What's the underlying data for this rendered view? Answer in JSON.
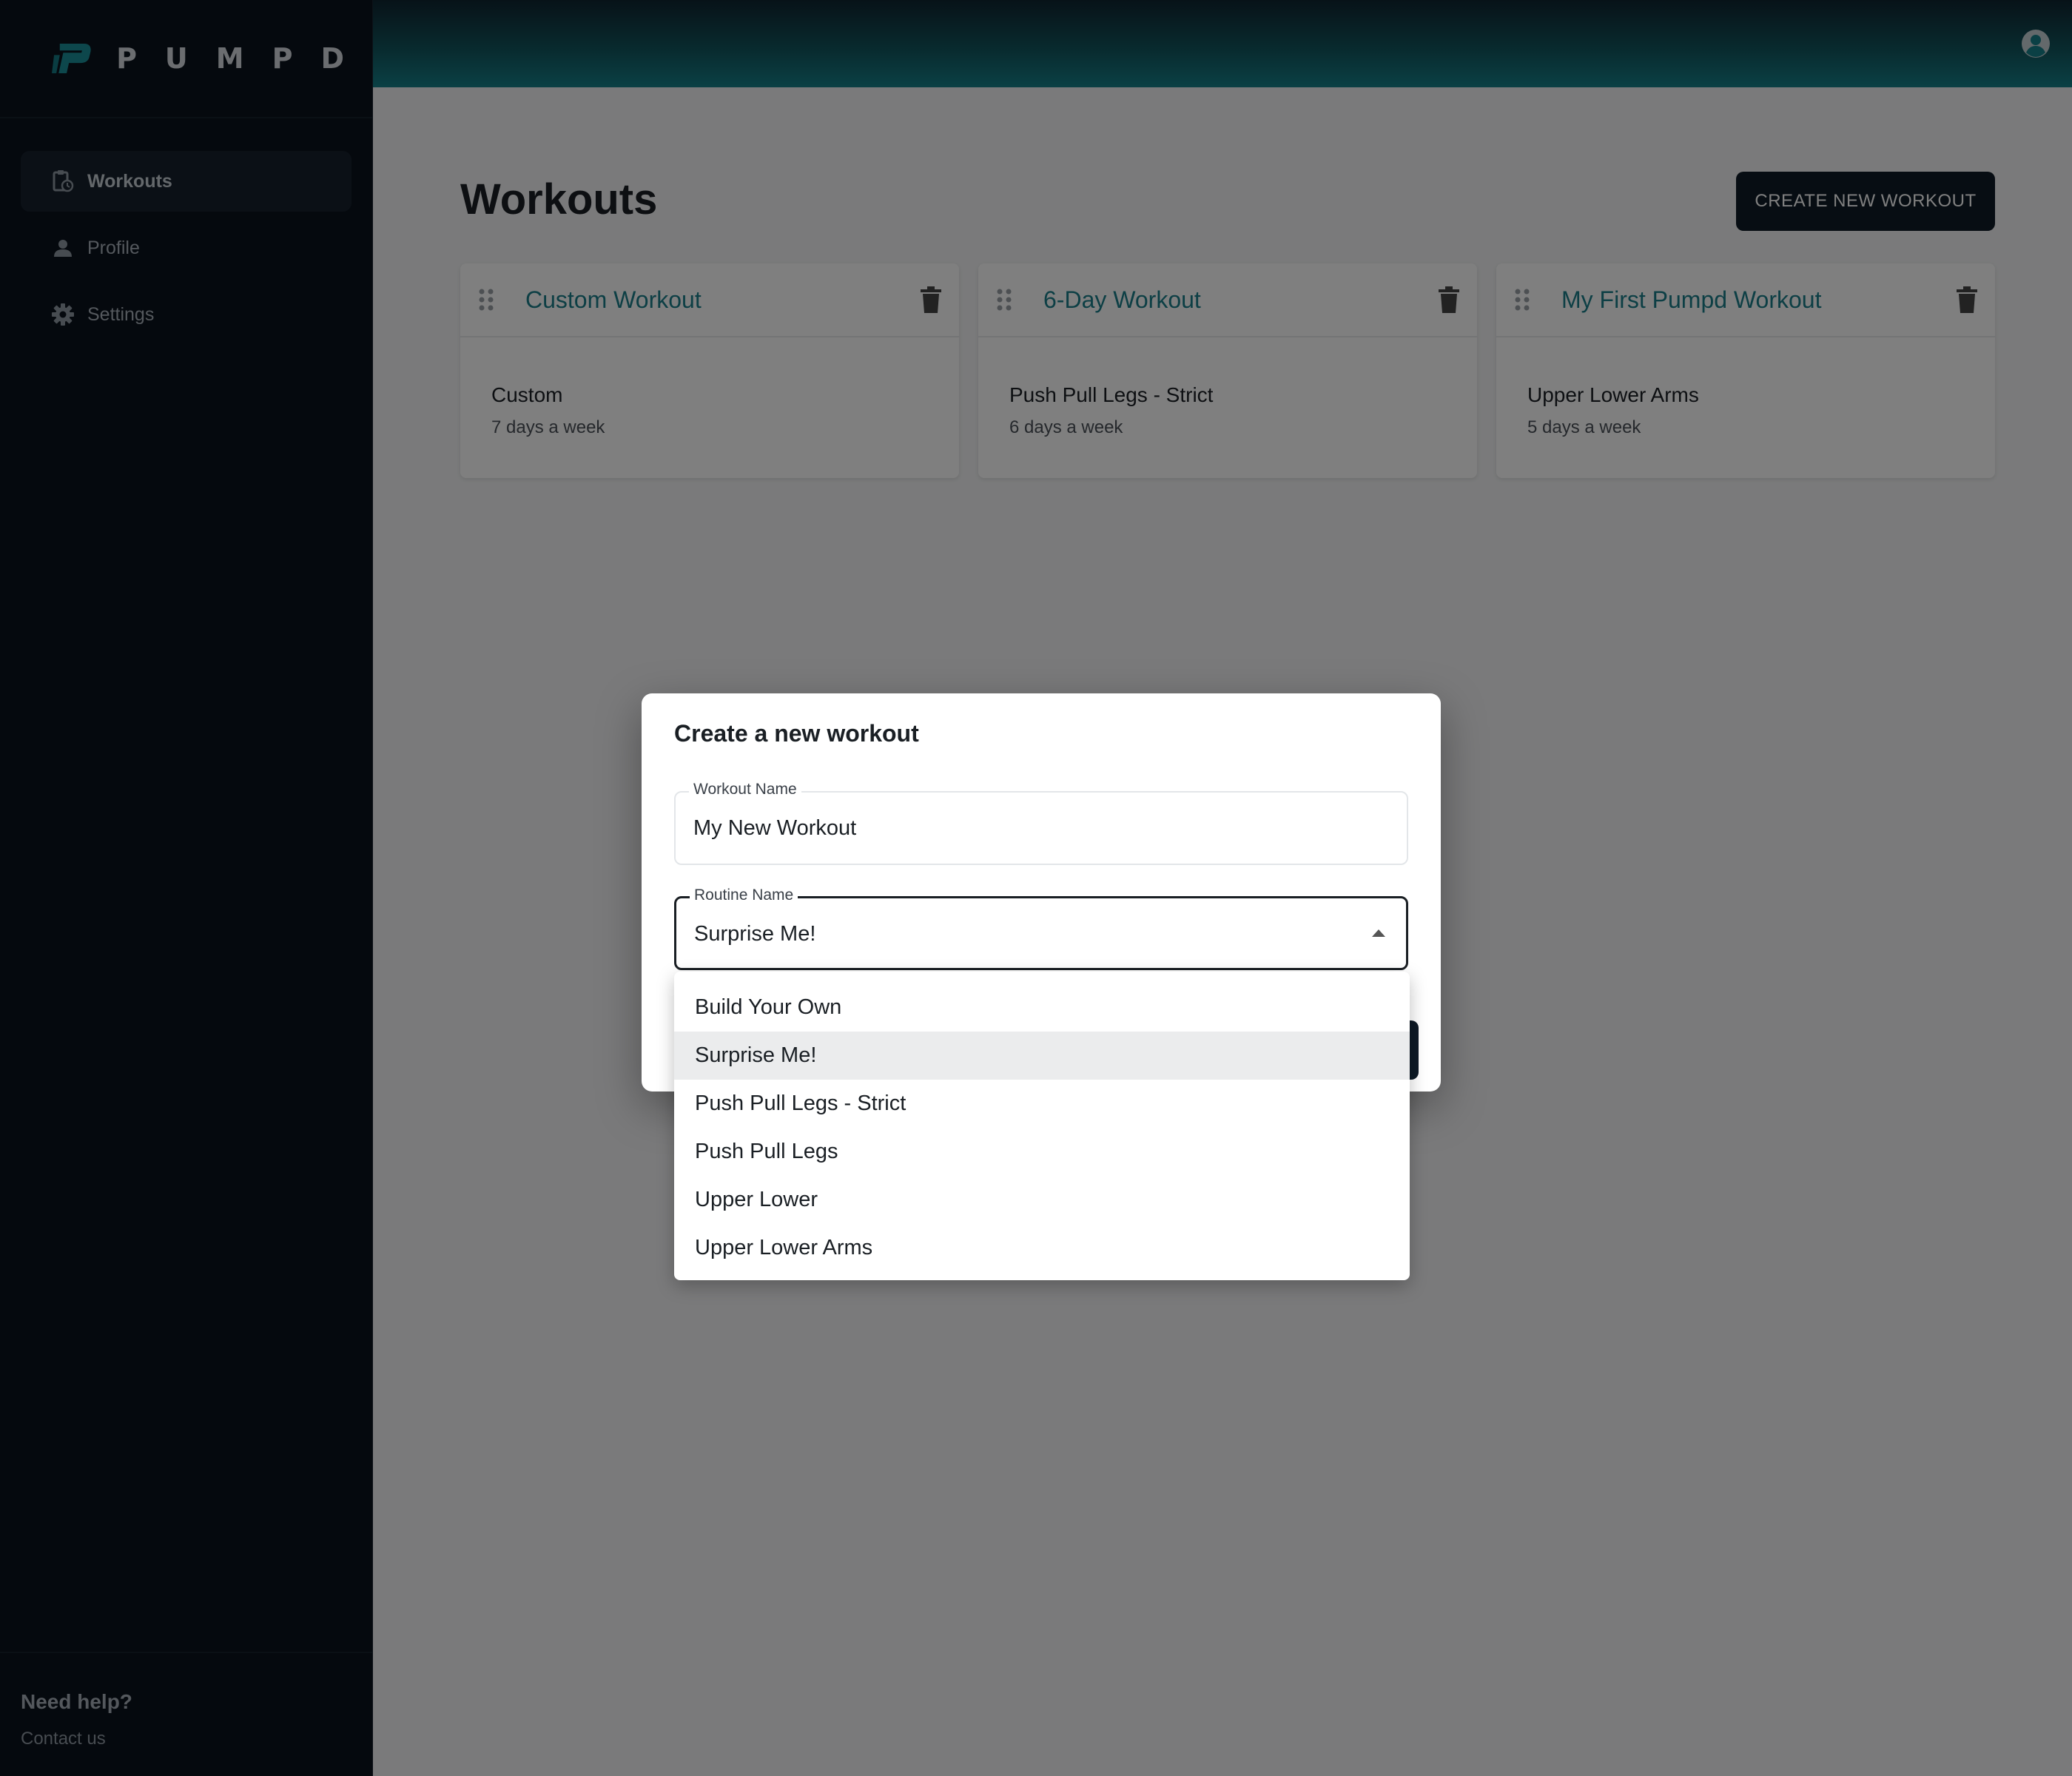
{
  "app": {
    "logo_text": "PUMPD",
    "accent_color": "#1b7f8a"
  },
  "sidebar": {
    "items": [
      {
        "label": "Workouts",
        "icon": "clipboard-clock-icon",
        "active": true
      },
      {
        "label": "Profile",
        "icon": "person-icon",
        "active": false
      },
      {
        "label": "Settings",
        "icon": "gear-icon",
        "active": false
      }
    ],
    "help_title": "Need help?",
    "help_link": "Contact us"
  },
  "header": {
    "avatar_icon": "account-circle-icon"
  },
  "main": {
    "title": "Workouts",
    "create_button": "CREATE NEW WORKOUT",
    "cards": [
      {
        "title": "Custom Workout",
        "routine": "Custom",
        "days": "7 days a week"
      },
      {
        "title": "6-Day Workout",
        "routine": "Push Pull Legs - Strict",
        "days": "6 days a week"
      },
      {
        "title": "My First Pumpd Workout",
        "routine": "Upper Lower Arms",
        "days": "5 days a week"
      }
    ]
  },
  "modal": {
    "title": "Create a new workout",
    "workout_name_label": "Workout Name",
    "workout_name_value": "My New Workout",
    "routine_label": "Routine Name",
    "routine_value": "Surprise Me!"
  },
  "dropdown": {
    "options": [
      "Build Your Own",
      "Surprise Me!",
      "Push Pull Legs - Strict",
      "Push Pull Legs",
      "Upper Lower",
      "Upper Lower Arms"
    ],
    "selected": "Surprise Me!"
  }
}
